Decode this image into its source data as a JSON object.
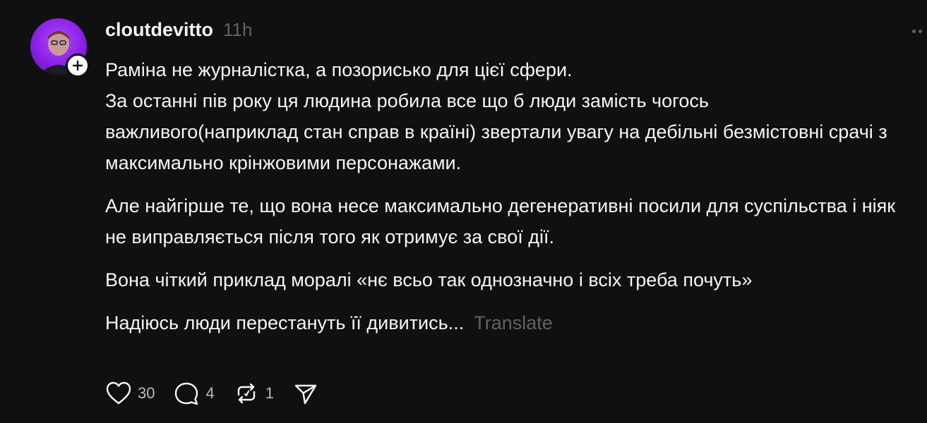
{
  "post": {
    "username": "cloutdevitto",
    "timestamp": "11h",
    "paragraphs": [
      "Раміна не журналістка, а позорисько для цієї сфери.\nЗа останні пів року ця людина робила все що б люди замість чогось важливого(наприклад стан справ в країні) звертали увагу на дебільні безмістовні срачі з максимально крінжовими персонажами.",
      "Але найгірше те, що вона несе максимально дегенеративні посили для суспільства і ніяк не виправляється після того як отримує за свої дії.",
      "Вона чіткий приклад моралі «нє всьо так однозначно і всіх треба почуть»",
      "Надіюсь люди перестануть її дивитись..."
    ],
    "translate_label": "Translate"
  },
  "actions": {
    "likes": "30",
    "replies": "4",
    "reposts": "1"
  },
  "icons": {
    "avatar": "user-avatar",
    "follow": "plus-icon",
    "more": "more-icon",
    "like": "heart-icon",
    "reply": "comment-icon",
    "repost": "repost-icon",
    "share": "share-icon"
  },
  "colors": {
    "background": "#101010",
    "text": "#f3f5f7",
    "muted": "#5f6166",
    "avatar_purple": "#8a1fe6"
  }
}
